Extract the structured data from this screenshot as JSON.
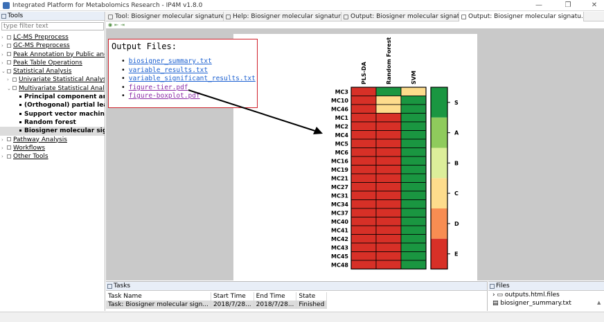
{
  "window": {
    "title": "Integrated Platform for Metabolomics Research - IP4M v1.8.0"
  },
  "left_panel": {
    "tab_label": "Tools",
    "filter_placeholder": "type filter text",
    "tree": [
      {
        "label": "LC-MS Preprocess",
        "level": 0,
        "arrow": "›",
        "box": true
      },
      {
        "label": "GC-MS Preprocess",
        "level": 0,
        "arrow": "›",
        "box": true
      },
      {
        "label": "Peak Annotation by Public and C",
        "level": 0,
        "arrow": "›",
        "box": true
      },
      {
        "label": "Peak Table Operations",
        "level": 0,
        "arrow": "›",
        "box": true
      },
      {
        "label": "Statistical Analysis",
        "level": 0,
        "arrow": "⌄",
        "box": true
      },
      {
        "label": "Univariate Statistical Analysis",
        "level": 1,
        "arrow": "›",
        "box": true
      },
      {
        "label": "Multivariate Statistical Analysis",
        "level": 1,
        "arrow": "⌄",
        "box": true
      },
      {
        "label": "Principal component analysi",
        "level": 2,
        "bold": true
      },
      {
        "label": "(Orthogonal) partial least sq",
        "level": 2,
        "bold": true
      },
      {
        "label": "Support vector machine",
        "level": 2,
        "bold": true
      },
      {
        "label": "Random forest",
        "level": 2,
        "bold": true
      },
      {
        "label": "Biosigner molecular signatu",
        "level": 2,
        "bold": true,
        "selected": true
      },
      {
        "label": "Pathway Analysis",
        "level": 0,
        "arrow": "›",
        "box": true
      },
      {
        "label": "Workflows",
        "level": 0,
        "arrow": "›",
        "box": true
      },
      {
        "label": "Other Tools",
        "level": 0,
        "arrow": "›",
        "box": true
      }
    ]
  },
  "editor_tabs": [
    {
      "label": "Tool: Biosigner molecular signature ...",
      "width": 170
    },
    {
      "label": "Help: Biosigner molecular signature ...",
      "width": 170
    },
    {
      "label": "Output: Biosigner molecular signatur...",
      "width": 170
    },
    {
      "label": "Output: Biosigner molecular signatu...",
      "width": 180,
      "active": true
    }
  ],
  "output": {
    "heading": "Output Files:",
    "files": [
      {
        "name": "biosigner_summary.txt",
        "visited": false
      },
      {
        "name": "variable_results.txt",
        "visited": false
      },
      {
        "name": "variable_significant_results.txt",
        "visited": false
      },
      {
        "name": "figure-tier.pdf",
        "visited": true
      },
      {
        "name": "figure-boxplot.pdf",
        "visited": true
      }
    ]
  },
  "chart_data": {
    "type": "heatmap",
    "columns": [
      "PLS-DA",
      "Random Forest",
      "SVM"
    ],
    "rows": [
      "MC3",
      "MC10",
      "MC46",
      "MC1",
      "MC2",
      "MC4",
      "MC5",
      "MC6",
      "MC16",
      "MC19",
      "MC21",
      "MC27",
      "MC31",
      "MC34",
      "MC37",
      "MC40",
      "MC41",
      "MC42",
      "MC43",
      "MC45",
      "MC48"
    ],
    "tiers": [
      [
        "E",
        "S",
        "C"
      ],
      [
        "E",
        "C",
        "S"
      ],
      [
        "E",
        "C",
        "S"
      ],
      [
        "E",
        "E",
        "S"
      ],
      [
        "E",
        "E",
        "S"
      ],
      [
        "E",
        "E",
        "S"
      ],
      [
        "E",
        "E",
        "S"
      ],
      [
        "E",
        "E",
        "S"
      ],
      [
        "E",
        "E",
        "S"
      ],
      [
        "E",
        "E",
        "S"
      ],
      [
        "E",
        "E",
        "S"
      ],
      [
        "E",
        "E",
        "S"
      ],
      [
        "E",
        "E",
        "S"
      ],
      [
        "E",
        "E",
        "S"
      ],
      [
        "E",
        "E",
        "S"
      ],
      [
        "E",
        "E",
        "S"
      ],
      [
        "E",
        "E",
        "S"
      ],
      [
        "E",
        "E",
        "S"
      ],
      [
        "E",
        "E",
        "S"
      ],
      [
        "E",
        "E",
        "S"
      ],
      [
        "E",
        "E",
        "S"
      ]
    ],
    "legend": [
      "S",
      "A",
      "B",
      "C",
      "D",
      "E"
    ],
    "colors": {
      "S": "#1a9641",
      "A": "#8fcb5c",
      "B": "#dcee9a",
      "C": "#fddc8c",
      "D": "#f88d52",
      "E": "#d73027"
    }
  },
  "tasks_panel": {
    "tab_label": "Tasks",
    "columns": [
      "Task Name",
      "Start Time",
      "End Time",
      "State"
    ],
    "rows": [
      [
        "Task: Biosigner molecular sign...",
        "2018/7/28...",
        "2018/7/28...",
        "Finished"
      ]
    ]
  },
  "files_panel": {
    "tab_label": "Files",
    "items": [
      "outputs.html.files",
      "biosigner_summary.txt"
    ]
  }
}
